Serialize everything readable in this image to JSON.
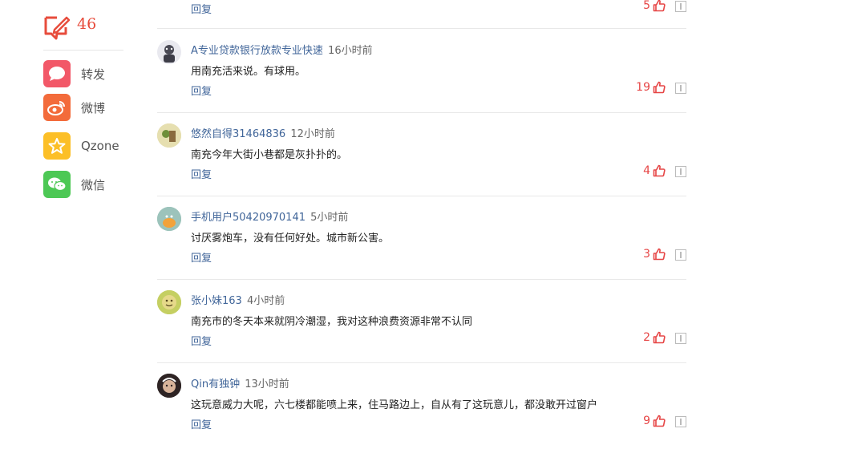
{
  "sidebar": {
    "comment_count": "46",
    "share": [
      {
        "label": "转发",
        "icon": "chat-bubble-icon",
        "color": "#f25868"
      },
      {
        "label": "微博",
        "icon": "weibo-icon",
        "color": "#f36b3b"
      },
      {
        "label": "Qzone",
        "icon": "qzone-star-icon",
        "color": "#fcbf27"
      },
      {
        "label": "微信",
        "icon": "wechat-icon",
        "color": "#4dc855"
      }
    ]
  },
  "top_partial": {
    "reply": "回复",
    "likes": "5"
  },
  "comments": [
    {
      "user": "A专业贷款银行放款专业快速",
      "time": "16小时前",
      "text": "用南充活来说。有球用。",
      "reply": "回复",
      "likes": "19"
    },
    {
      "user": "悠然自得31464836",
      "time": "12小时前",
      "text": "南充今年大街小巷都是灰扑扑的。",
      "reply": "回复",
      "likes": "4"
    },
    {
      "user": "手机用户50420970141",
      "time": "5小时前",
      "text": "讨厌雾炮车，没有任何好处。城市新公害。",
      "reply": "回复",
      "likes": "3"
    },
    {
      "user": "张小妹163",
      "time": "4小时前",
      "text": "南充市的冬天本来就阴冷潮湿，我对这种浪费资源非常不认同",
      "reply": "回复",
      "likes": "2"
    },
    {
      "user": "Qin有独钟",
      "time": "13小时前",
      "text": "这玩意威力大呢，六七楼都能喷上来，住马路边上，自从有了这玩意儿，都没敢开过窗户",
      "reply": "回复",
      "likes": "9"
    }
  ],
  "colors": {
    "accent": "#e74c3c",
    "link": "#406599",
    "like": "#e64545"
  }
}
